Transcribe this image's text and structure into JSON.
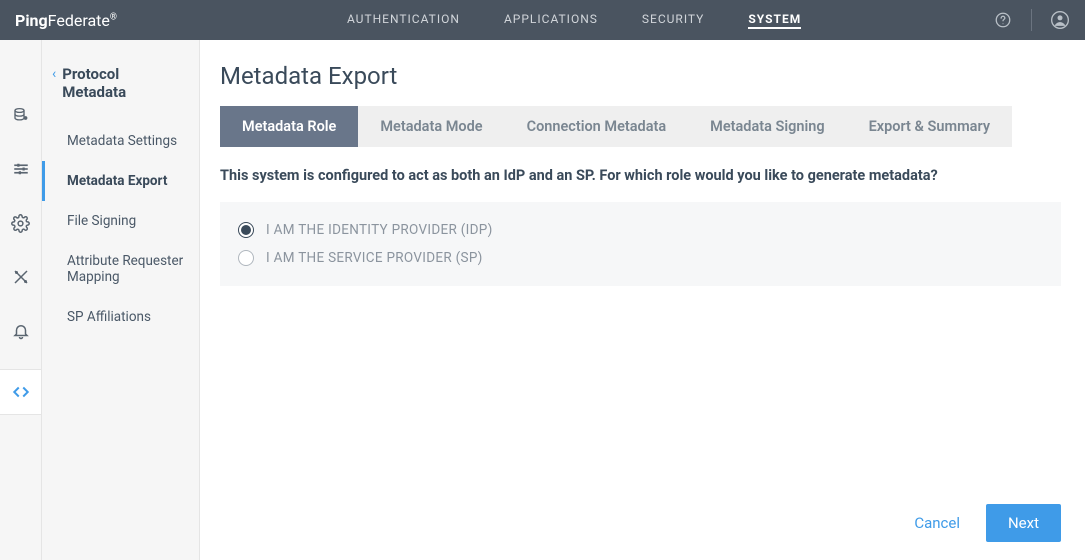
{
  "header": {
    "logo": {
      "brand_strong": "Ping",
      "brand_light": "Federate"
    },
    "nav": [
      "AUTHENTICATION",
      "APPLICATIONS",
      "SECURITY",
      "SYSTEM"
    ],
    "nav_active_index": 3
  },
  "sidebar": {
    "heading": "Protocol Metadata",
    "items": [
      {
        "label": "Metadata Settings"
      },
      {
        "label": "Metadata Export"
      },
      {
        "label": "File Signing"
      },
      {
        "label": "Attribute Requester Mapping"
      },
      {
        "label": "SP Affiliations"
      }
    ],
    "active_index": 1
  },
  "main": {
    "title": "Metadata Export",
    "tabs": [
      "Metadata Role",
      "Metadata Mode",
      "Connection Metadata",
      "Metadata Signing",
      "Export & Summary"
    ],
    "tabs_active_index": 0,
    "description": "This system is configured to act as both an IdP and an SP. For which role would you like to generate metadata?",
    "radio_options": [
      {
        "label": "I AM THE IDENTITY PROVIDER (IDP)",
        "selected": true
      },
      {
        "label": "I AM THE SERVICE PROVIDER (SP)",
        "selected": false
      }
    ]
  },
  "footer": {
    "cancel": "Cancel",
    "next": "Next"
  }
}
